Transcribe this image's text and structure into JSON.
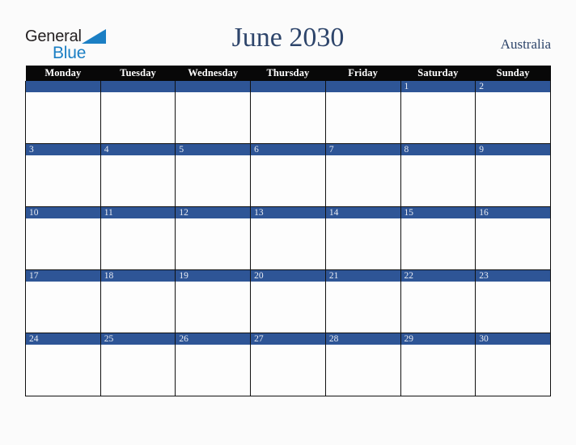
{
  "brand": {
    "name_part1": "General",
    "name_part2": "Blue",
    "triangle_icon": "blue-triangle-icon",
    "color_dark": "#231f20",
    "color_blue": "#1b7fc4"
  },
  "header": {
    "title": "June 2030",
    "country": "Australia",
    "title_color": "#2e456b"
  },
  "calendar": {
    "month": "June",
    "year": "2030",
    "accent_color": "#2e5596",
    "header_bg": "#080808",
    "weekday_headers": [
      "Monday",
      "Tuesday",
      "Wednesday",
      "Thursday",
      "Friday",
      "Saturday",
      "Sunday"
    ],
    "weeks": [
      [
        "",
        "",
        "",
        "",
        "",
        "1",
        "2"
      ],
      [
        "3",
        "4",
        "5",
        "6",
        "7",
        "8",
        "9"
      ],
      [
        "10",
        "11",
        "12",
        "13",
        "14",
        "15",
        "16"
      ],
      [
        "17",
        "18",
        "19",
        "20",
        "21",
        "22",
        "23"
      ],
      [
        "24",
        "25",
        "26",
        "27",
        "28",
        "29",
        "30"
      ]
    ]
  }
}
